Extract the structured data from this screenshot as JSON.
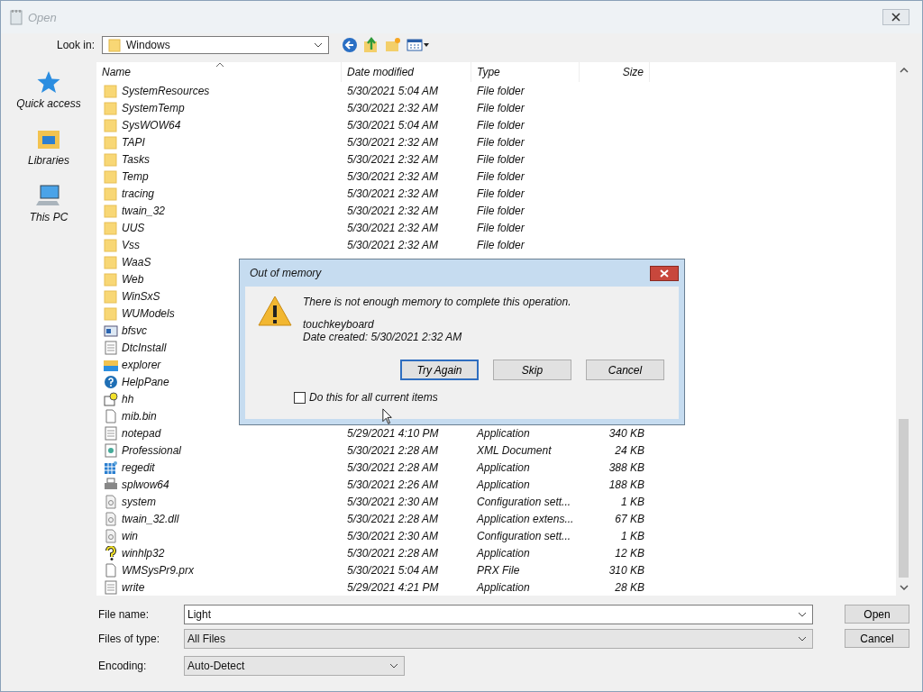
{
  "window": {
    "title": "Open",
    "active": false
  },
  "look_in": {
    "label": "Look in:",
    "value": "Windows"
  },
  "places": [
    {
      "label": "Quick access",
      "kind": "star"
    },
    {
      "label": "Libraries",
      "kind": "library"
    },
    {
      "label": "This PC",
      "kind": "pc"
    }
  ],
  "columns": [
    "Name",
    "Date modified",
    "Type",
    "Size"
  ],
  "rows": [
    {
      "name": "SystemResources",
      "kind": "folder",
      "date": "5/30/2021 5:04 AM",
      "type": "File folder"
    },
    {
      "name": "SystemTemp",
      "kind": "folder",
      "date": "5/30/2021 2:32 AM",
      "type": "File folder"
    },
    {
      "name": "SysWOW64",
      "kind": "folder",
      "date": "5/30/2021 5:04 AM",
      "type": "File folder"
    },
    {
      "name": "TAPI",
      "kind": "folder",
      "date": "5/30/2021 2:32 AM",
      "type": "File folder"
    },
    {
      "name": "Tasks",
      "kind": "folder",
      "date": "5/30/2021 2:32 AM",
      "type": "File folder"
    },
    {
      "name": "Temp",
      "kind": "folder",
      "date": "5/30/2021 2:32 AM",
      "type": "File folder"
    },
    {
      "name": "tracing",
      "kind": "folder",
      "date": "5/30/2021 2:32 AM",
      "type": "File folder"
    },
    {
      "name": "twain_32",
      "kind": "folder",
      "date": "5/30/2021 2:32 AM",
      "type": "File folder"
    },
    {
      "name": "UUS",
      "kind": "folder",
      "date": "5/30/2021 2:32 AM",
      "type": "File folder"
    },
    {
      "name": "Vss",
      "kind": "folder",
      "date": "5/30/2021 2:32 AM",
      "type": "File folder"
    },
    {
      "name": "WaaS",
      "kind": "folder"
    },
    {
      "name": "Web",
      "kind": "folder"
    },
    {
      "name": "WinSxS",
      "kind": "folder"
    },
    {
      "name": "WUModels",
      "kind": "folder"
    },
    {
      "name": "bfsvc",
      "kind": "window"
    },
    {
      "name": "DtcInstall",
      "kind": "text"
    },
    {
      "name": "explorer",
      "kind": "explorer"
    },
    {
      "name": "HelpPane",
      "kind": "help"
    },
    {
      "name": "hh",
      "kind": "script"
    },
    {
      "name": "mib.bin",
      "kind": "blank"
    },
    {
      "name": "notepad",
      "kind": "text",
      "date": "5/29/2021 4:10 PM",
      "type": "Application",
      "size": "340 KB"
    },
    {
      "name": "Professional",
      "kind": "xml",
      "date": "5/30/2021 2:28 AM",
      "type": "XML Document",
      "size": "24 KB"
    },
    {
      "name": "regedit",
      "kind": "grid",
      "date": "5/30/2021 2:28 AM",
      "type": "Application",
      "size": "388 KB"
    },
    {
      "name": "splwow64",
      "kind": "printer",
      "date": "5/30/2021 2:26 AM",
      "type": "Application",
      "size": "188 KB"
    },
    {
      "name": "system",
      "kind": "config",
      "date": "5/30/2021 2:30 AM",
      "type": "Configuration sett...",
      "size": "1 KB"
    },
    {
      "name": "twain_32.dll",
      "kind": "config",
      "date": "5/30/2021 2:28 AM",
      "type": "Application extens...",
      "size": "67 KB"
    },
    {
      "name": "win",
      "kind": "config",
      "date": "5/30/2021 2:30 AM",
      "type": "Configuration sett...",
      "size": "1 KB"
    },
    {
      "name": "winhlp32",
      "kind": "question",
      "date": "5/30/2021 2:28 AM",
      "type": "Application",
      "size": "12 KB"
    },
    {
      "name": "WMSysPr9.prx",
      "kind": "blank",
      "date": "5/30/2021 5:04 AM",
      "type": "PRX File",
      "size": "310 KB"
    },
    {
      "name": "write",
      "kind": "text",
      "date": "5/29/2021 4:21 PM",
      "type": "Application",
      "size": "28 KB"
    }
  ],
  "fields": [
    {
      "label": "File name:",
      "value": "Light",
      "kind": "combo"
    },
    {
      "label": "Files of type:",
      "value": "All Files",
      "kind": "select"
    },
    {
      "label": "Encoding:",
      "value": "Auto-Detect",
      "kind": "select"
    }
  ],
  "buttons": [
    "Open",
    "Cancel"
  ],
  "dialog": {
    "title": "Out of memory",
    "message": "There is not enough memory to complete this operation.",
    "item": "touchkeyboard",
    "detail": "Date created: 5/30/2021 2:32 AM",
    "buttons": [
      {
        "label": "Try Again",
        "default": true
      },
      {
        "label": "Skip",
        "default": false
      },
      {
        "label": "Cancel",
        "default": false
      }
    ],
    "checkbox": {
      "label": "Do this for all current items",
      "checked": false
    }
  }
}
